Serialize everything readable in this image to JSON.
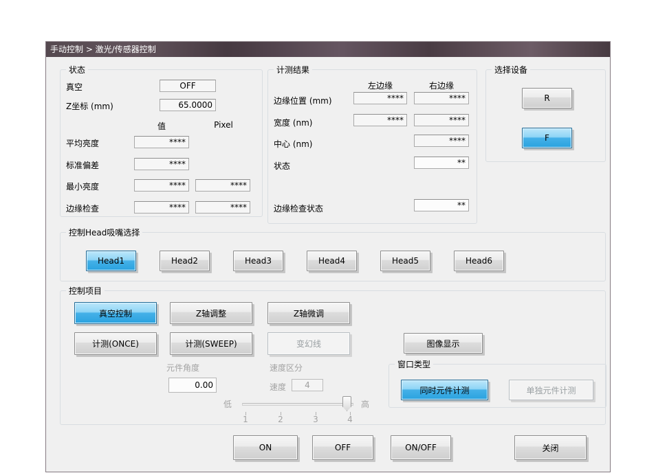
{
  "window": {
    "title": "手动控制 > 激光/传感器控制"
  },
  "status": {
    "title": "状态",
    "vacuum_label": "真空",
    "vacuum_value": "OFF",
    "z_label": "Z坐标 (mm)",
    "z_value": "65.0000",
    "col_value": "值",
    "col_pixel": "Pixel",
    "rows": [
      {
        "label": "平均亮度",
        "value": "****"
      },
      {
        "label": "标准偏差",
        "value": "****"
      },
      {
        "label": "最小亮度",
        "value": "****",
        "pixel": "****"
      },
      {
        "label": "边缘检查",
        "value": "****",
        "pixel": "****"
      }
    ]
  },
  "results": {
    "title": "计测结果",
    "col_left": "左边缘",
    "col_right": "右边缘",
    "rows": [
      {
        "label": "边缘位置 (mm)",
        "left": "****",
        "right": "****"
      },
      {
        "label": "宽度 (nm)",
        "left": "****",
        "right": "****"
      },
      {
        "label": "中心 (nm)",
        "right": "****"
      },
      {
        "label": "状态",
        "right": "**"
      },
      {
        "label": "边缘检查状态",
        "right": "**"
      }
    ]
  },
  "device": {
    "title": "选择设备",
    "r_label": "R",
    "f_label": "F"
  },
  "heads": {
    "title": "控制Head吸嘴选择",
    "buttons": [
      "Head1",
      "Head2",
      "Head3",
      "Head4",
      "Head5",
      "Head6"
    ],
    "selected": "Head1"
  },
  "controls": {
    "title": "控制项目",
    "vacuum_control": "真空控制",
    "z_adjust": "Z轴调整",
    "z_fine": "Z轴微调",
    "measure_once": "计测(ONCE)",
    "measure_sweep": "计测(SWEEP)",
    "magic_line": "变幻线",
    "image_display": "图像显示"
  },
  "angle": {
    "label": "元件角度",
    "value": "0.00"
  },
  "speed": {
    "title": "速度区分",
    "label": "速度",
    "value": "4",
    "low": "低",
    "high": "高",
    "ticks": [
      "1",
      "2",
      "3",
      "4"
    ]
  },
  "window_type": {
    "title": "窗口类型",
    "simultaneous": "同时元件计测",
    "individual": "单独元件计测"
  },
  "footer": {
    "on": "ON",
    "off": "OFF",
    "onoff": "ON/OFF",
    "close": "关闭"
  },
  "colors": {
    "selected_button": "#3fa9e0",
    "titlebar": "#4d3f47",
    "dialog_bg": "#f0f0f0"
  }
}
